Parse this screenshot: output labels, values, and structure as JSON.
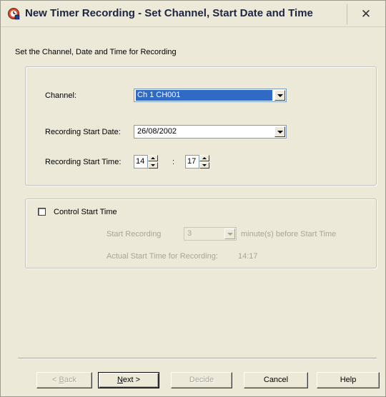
{
  "window": {
    "title": "New Timer Recording - Set Channel, Start Date and Time",
    "close_glyph": "✕"
  },
  "instruction": "Set the Channel, Date and Time for Recording",
  "channel": {
    "label": "Channel:",
    "value": "Ch 1 CH001"
  },
  "start_date": {
    "label": "Recording Start Date:",
    "value": "26/08/2002"
  },
  "start_time": {
    "label": "Recording Start Time:",
    "hour": "14",
    "separator": ":",
    "minute": "17"
  },
  "control": {
    "checkbox_label": "Control Start Time",
    "checked": false,
    "start_recording_label": "Start Recording",
    "minutes_value": "3",
    "minutes_suffix": "minute(s) before Start Time",
    "actual_label": "Actual Start Time for Recording:",
    "actual_value": "14:17"
  },
  "buttons": {
    "back_prefix": "< ",
    "back_key": "B",
    "back_rest": "ack",
    "next_key": "N",
    "next_rest": "ext >",
    "decide": "Decide",
    "cancel": "Cancel",
    "help": "Help"
  },
  "icons": {
    "title_icon": "app-recording-icon",
    "dropdown_icon": "chevron-down-icon",
    "spin_icon": "spin-arrows-icon"
  }
}
